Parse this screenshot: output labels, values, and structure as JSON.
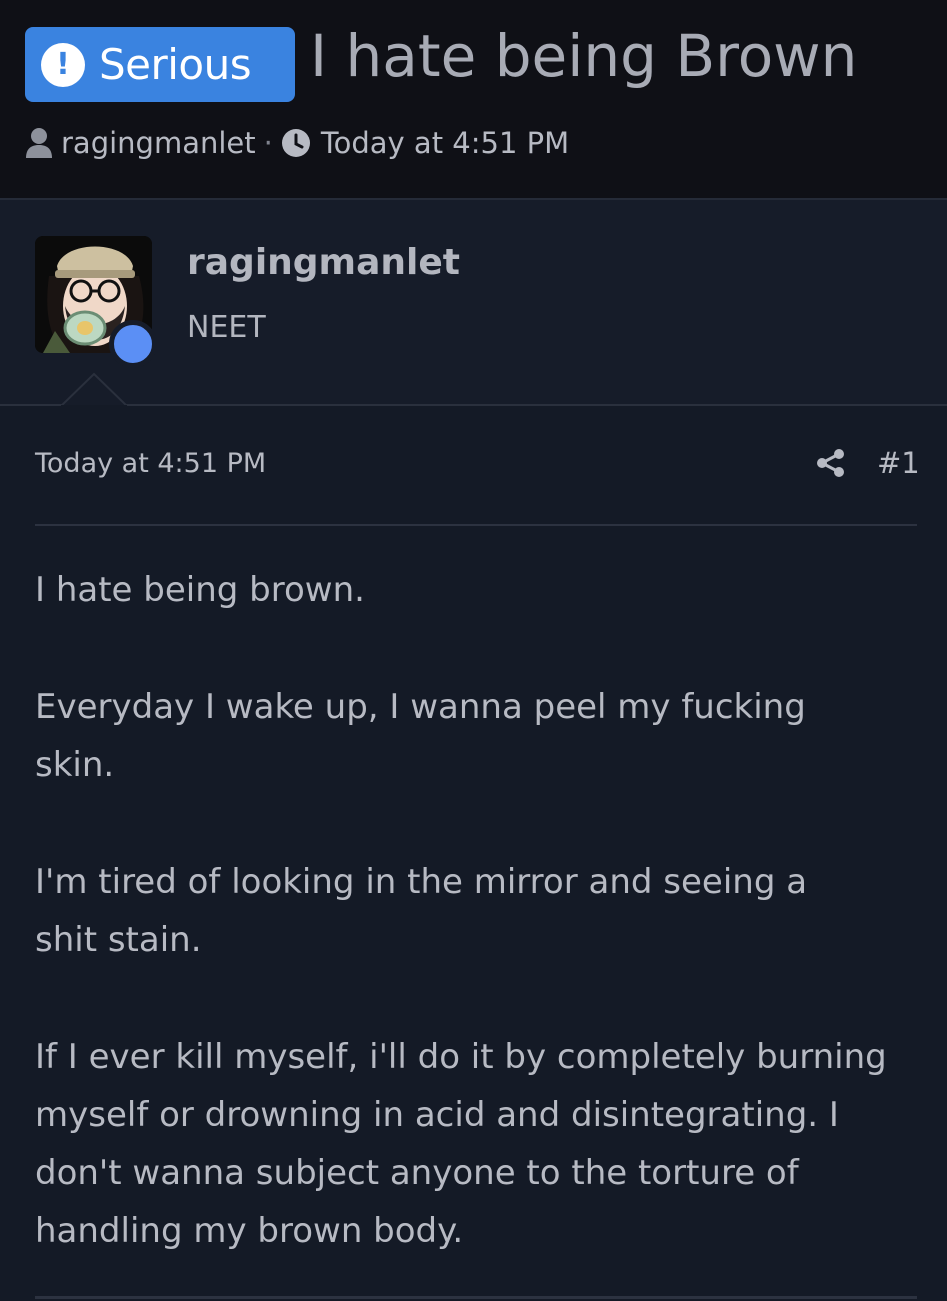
{
  "thread": {
    "prefix_badge": "Serious",
    "title": "I hate being Brown",
    "author": "ragingmanlet",
    "separator": "·",
    "date": "Today at 4:51 PM"
  },
  "post": {
    "author_name": "ragingmanlet",
    "author_title": "NEET",
    "date": "Today at 4:51 PM",
    "number": "#1",
    "paragraphs": [
      "I hate being brown.",
      "Everyday I wake up, I wanna peel my fucking skin.",
      "I'm tired of looking in the mirror and seeing a shit stain.",
      "If I ever kill myself, i'll do it by completely burning myself or drowning in acid and disintegrating. I don't wanna subject anyone to the torture of handling my brown body."
    ]
  },
  "colors": {
    "badge": "#3a83e0",
    "online_indicator": "#5b8ff5",
    "background": "#0f1117",
    "post_header_bg": "#161c29"
  },
  "icons": {
    "badge": "exclamation-icon",
    "author": "user-icon",
    "date": "clock-icon",
    "share": "share-icon"
  }
}
